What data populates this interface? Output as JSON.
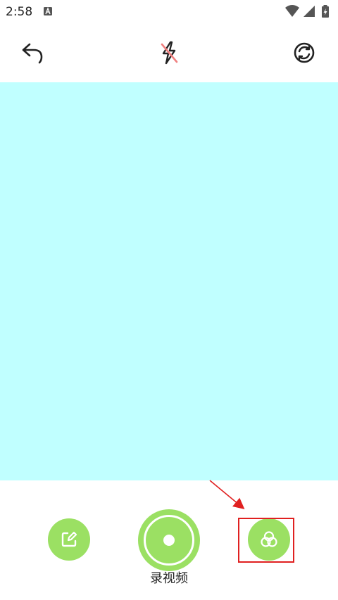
{
  "status_bar": {
    "time": "2:58",
    "notification_icon": "a-badge-icon",
    "icons": [
      "wifi-icon",
      "signal-icon",
      "battery-charging-icon"
    ]
  },
  "top_bar": {
    "buttons": [
      "back-icon",
      "flash-off-icon",
      "switch-camera-icon"
    ]
  },
  "bottom_bar": {
    "edit_button_icon": "edit-icon",
    "record_label": "录视频",
    "filter_button_icon": "filter-icon"
  },
  "colors": {
    "preview_background": "#c0ffff",
    "accent_green": "#9be063",
    "highlight_red": "#e02020",
    "flash_slash": "#f08080"
  }
}
